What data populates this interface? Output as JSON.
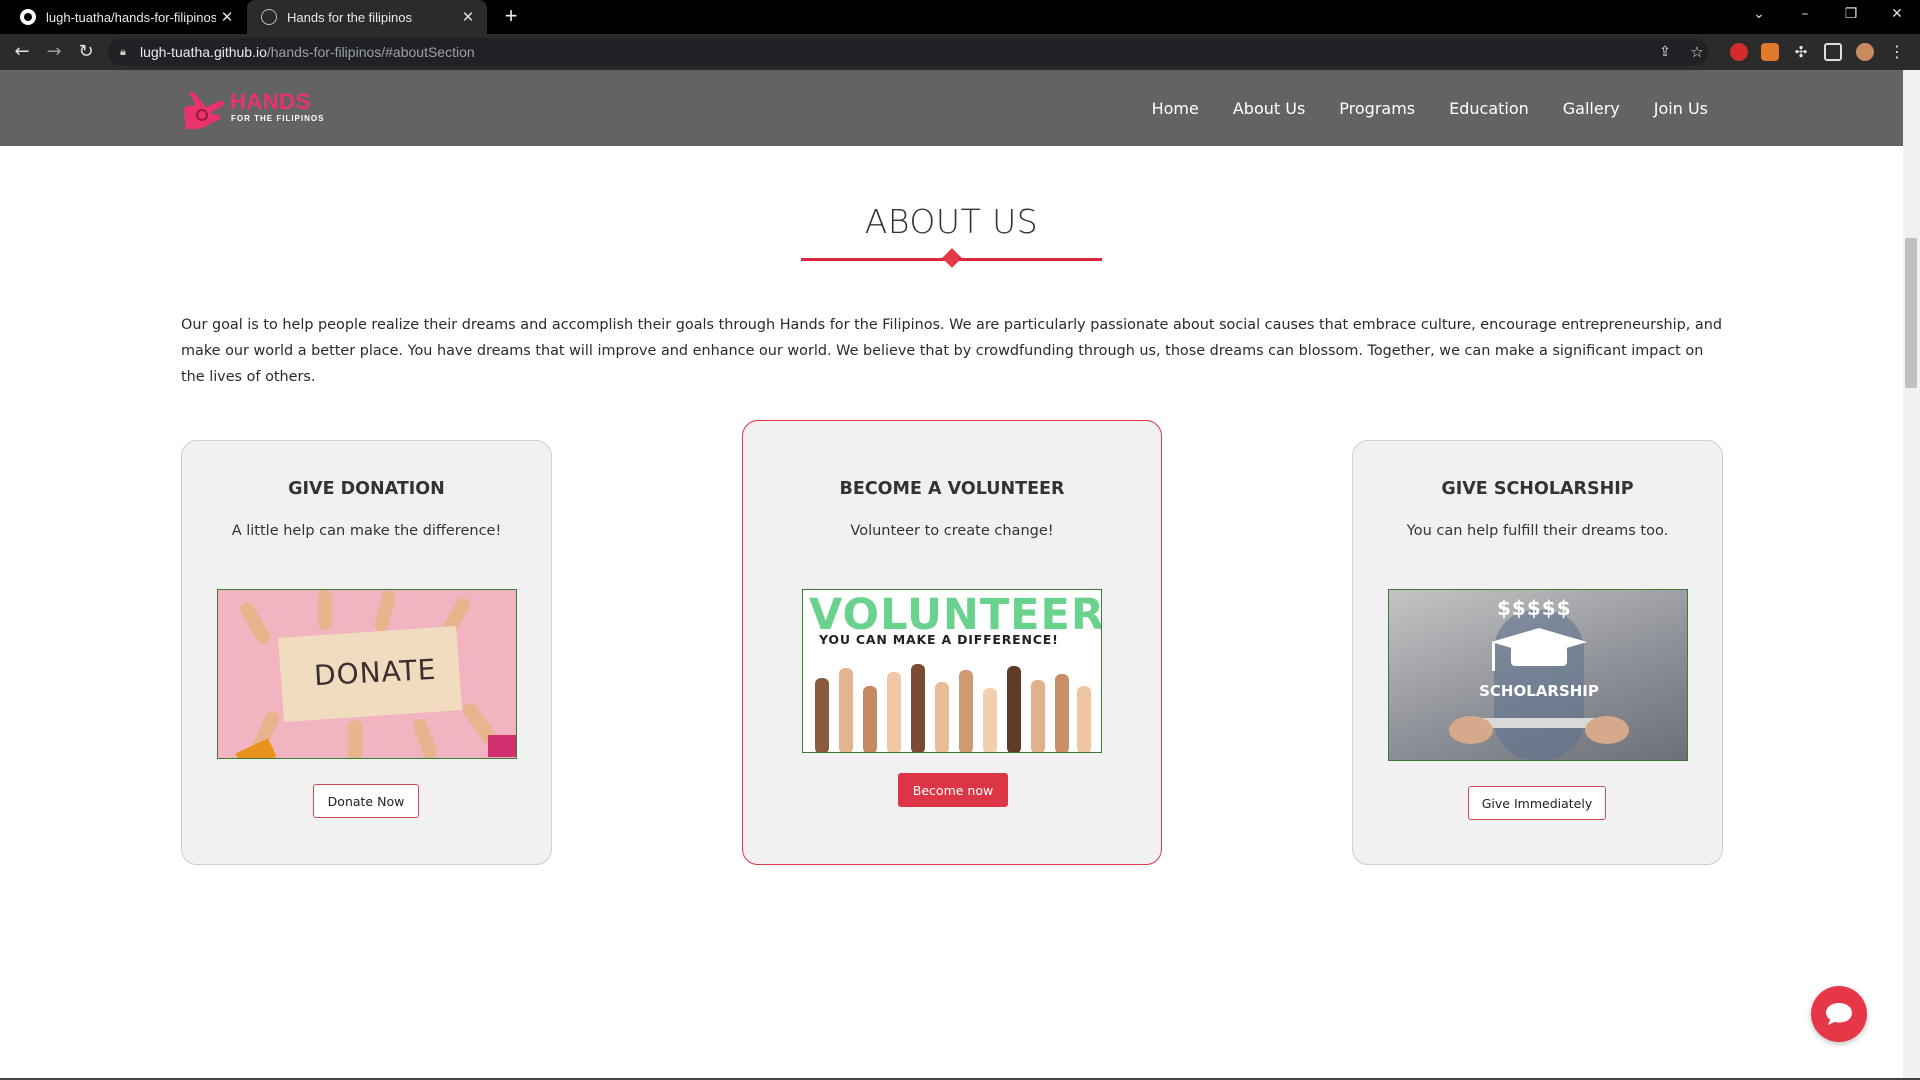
{
  "browser": {
    "tabs": [
      {
        "title": "lugh-tuatha/hands-for-filipinos",
        "active": false
      },
      {
        "title": "Hands for the filipinos",
        "active": true
      }
    ],
    "new_tab": "+",
    "url_host": "lugh-tuatha.github.io",
    "url_path": "/hands-for-filipinos/#aboutSection"
  },
  "site": {
    "logo_word": "HANDS",
    "logo_sub": "FOR THE FILIPINOS",
    "nav": [
      "Home",
      "About Us",
      "Programs",
      "Education",
      "Gallery",
      "Join Us"
    ]
  },
  "about": {
    "title": "ABOUT US",
    "intro": "Our goal is to help people realize their dreams and accomplish their goals through Hands for the Filipinos. We are particularly passionate about social causes that embrace culture, encourage entrepreneurship, and make our world a better place. You have dreams that will improve and enhance our world. We believe that by crowdfunding through us, those dreams can blossom. Together, we can make a significant impact on the lives of others."
  },
  "cards": [
    {
      "title": "GIVE DONATION",
      "text": "A little help can make the difference!",
      "image_text": "DONATE",
      "button": "Donate Now"
    },
    {
      "title": "BECOME A VOLUNTEER",
      "text": "Volunteer to create change!",
      "image_text": "VOLUNTEER",
      "image_subtext": "YOU CAN MAKE A DIFFERENCE!",
      "button": "Become now"
    },
    {
      "title": "GIVE SCHOLARSHIP",
      "text": "You can help fulfill their dreams too.",
      "image_text": "SCHOLARSHIP",
      "image_symbols": "$$$$$",
      "button": "Give Immediately"
    }
  ],
  "colors": {
    "accent": "#dc3545",
    "header_bg": "#636363",
    "logo_pink": "#e8336d",
    "volunteer_green": "#69d38e"
  },
  "icons": [
    "github-icon",
    "globe-icon",
    "back-arrow-icon",
    "forward-arrow-icon",
    "reload-icon",
    "lock-icon",
    "share-icon",
    "star-icon",
    "extensions-icon",
    "sidepanel-icon",
    "profile-icon",
    "menu-icon",
    "chat-icon"
  ]
}
